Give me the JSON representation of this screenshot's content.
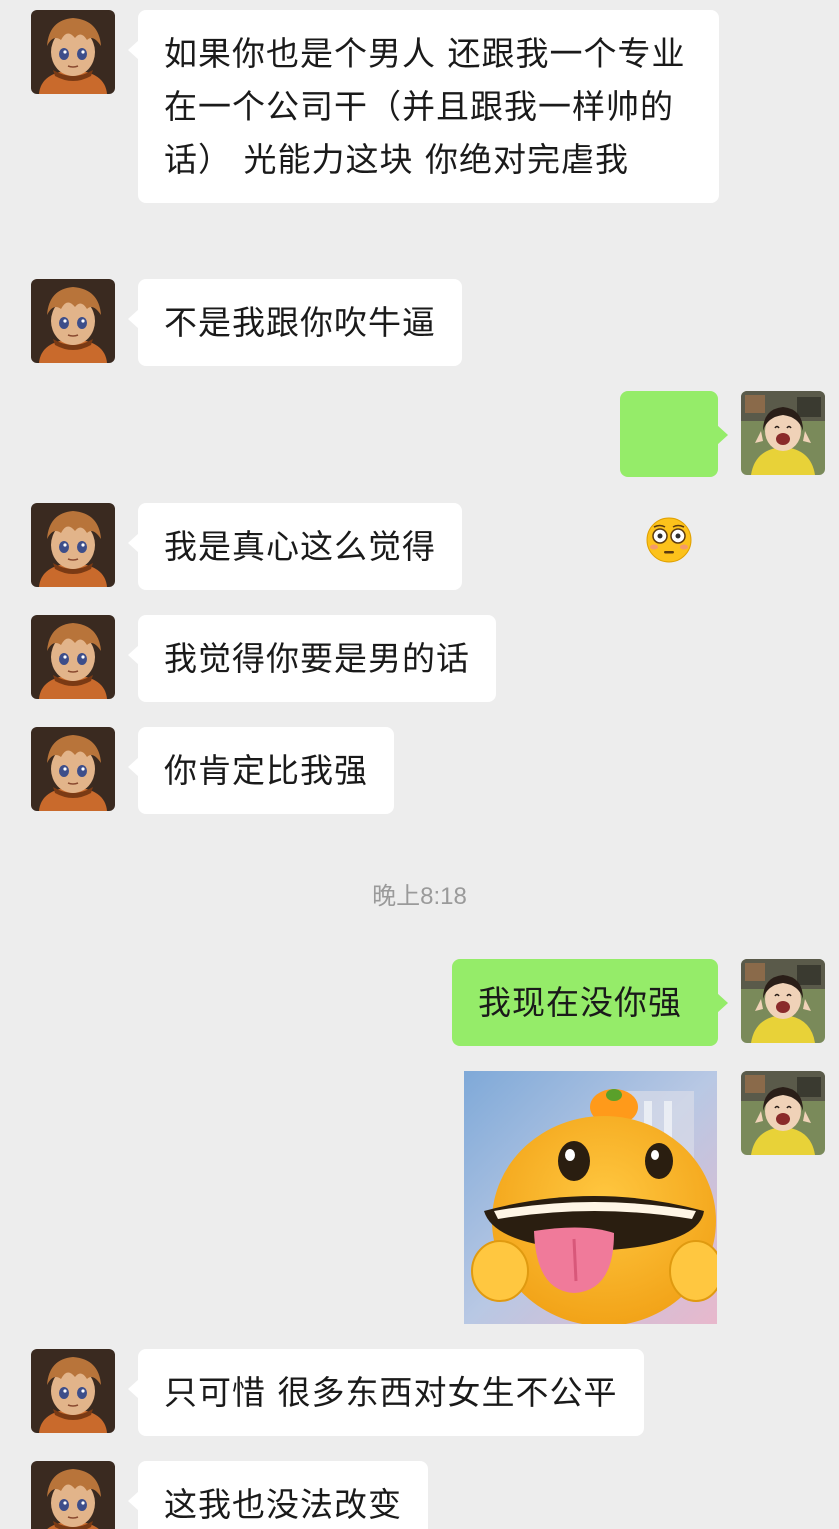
{
  "chat": {
    "messages": [
      {
        "side": "in",
        "text": "如果你也是个男人 还跟我一个专业 在一个公司干（并且跟我一样帅的话） 光能力这块 你绝对完虐我"
      },
      {
        "side": "in",
        "text": "不是我跟你吹牛逼"
      },
      {
        "side": "out",
        "emoji": "flushed-face-emoji"
      },
      {
        "side": "in",
        "text": "我是真心这么觉得"
      },
      {
        "side": "in",
        "text": "我觉得你要是男的话"
      },
      {
        "side": "in",
        "text": "你肯定比我强"
      },
      {
        "type": "timestamp",
        "text": "晚上8:18"
      },
      {
        "side": "out",
        "text": "我现在没你强"
      },
      {
        "side": "out",
        "sticker": "yellow-dinosaur-tongue-sticker"
      },
      {
        "side": "in",
        "text": "只可惜 很多东西对女生不公平"
      },
      {
        "side": "in",
        "text": "这我也没法改变"
      }
    ]
  },
  "colors": {
    "background": "#ededed",
    "incoming_bubble": "#ffffff",
    "outgoing_bubble": "#95ec69",
    "timestamp_text": "#9a9a9a"
  }
}
